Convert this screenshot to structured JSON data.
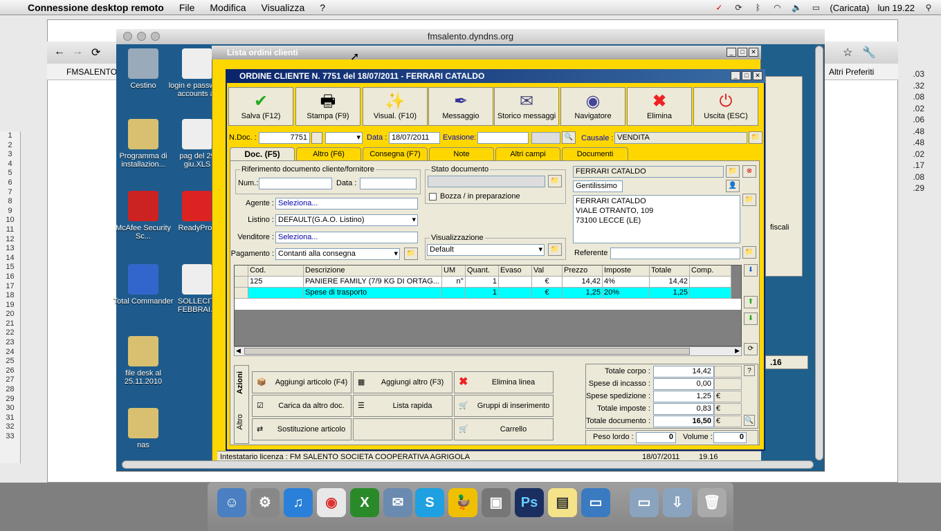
{
  "menubar": {
    "app": "Connessione desktop remoto",
    "menus": [
      "File",
      "Modifica",
      "Visualizza",
      "?"
    ],
    "battery": "(Caricata)",
    "clock": "lun 19.22"
  },
  "rd_title": "fmsalento.dyndns.org",
  "chrome": {
    "bookmark": "FMSALENTO",
    "other_bookmarks": "Altri Preferiti"
  },
  "desktop_icons": [
    {
      "label": "Cestino"
    },
    {
      "label": "login e password accounts ar"
    },
    {
      "label": "Programma di installazion..."
    },
    {
      "label": "pag del 29 giu.XLS"
    },
    {
      "label": "McAfee Security Sc..."
    },
    {
      "label": "ReadyProd"
    },
    {
      "label": "Total Commander"
    },
    {
      "label": "SOLLECITI FEBBRAI..."
    },
    {
      "label": "file desk al 25.11.2010"
    },
    {
      "label": "nas"
    }
  ],
  "sheet_rows": [
    "1",
    "2",
    "3",
    "4",
    "5",
    "6",
    "7",
    "8",
    "9",
    "10",
    "11",
    "12",
    "13",
    "14",
    "15",
    "16",
    "17",
    "18",
    "19",
    "20",
    "21",
    "22",
    "23",
    "24",
    "25",
    "26",
    "27",
    "28",
    "29",
    "30",
    "31",
    "32",
    "33"
  ],
  "right_values": [
    ".03",
    ".32",
    ".08",
    ".02",
    ".06",
    ".48",
    ".48",
    ".02",
    ".17",
    ".08",
    ".29"
  ],
  "lista": {
    "title": "Lista ordini clienti",
    "status_left": "Intestatario licenza : FM SALENTO SOCIETA COOPERATIVA AGRIGOLA",
    "status_date": "18/07/2011",
    "status_time": "19.16",
    "side_label": "fiscali",
    "side_value": ".16"
  },
  "ordine": {
    "title": "ORDINE CLIENTE N. 7751  del 18/07/2011 - FERRARI CATALDO",
    "toolbar": [
      "Salva (F12)",
      "Stampa (F9)",
      "Visual. (F10)",
      "Messaggio",
      "Storico messaggi",
      "Navigatore",
      "Elimina",
      "Uscita (ESC)"
    ],
    "ndoc_label": "N.Doc. :",
    "ndoc": "7751",
    "data_label": "Data :",
    "data": "18/07/2011",
    "evasione_label": "Evasione:",
    "causale_label": "Causale :",
    "causale": "VENDITA",
    "tabs": [
      "Doc. (F5)",
      "Altro (F6)",
      "Consegna (F7)",
      "Note",
      "Altri campi",
      "Documenti"
    ],
    "rif_group": "Riferimento documento cliente/fornitore",
    "num_label": "Num.:",
    "data2_label": "Data :",
    "agente_label": "Agente :",
    "agente": "Seleziona...",
    "listino_label": "Listino :",
    "listino": "DEFAULT(G.A.O. Listino)",
    "venditore_label": "Venditore :",
    "venditore": "Seleziona...",
    "pagamento_label": "Pagamento :",
    "pagamento": "Contanti alla consegna",
    "stato_group": "Stato documento",
    "bozza": "Bozza / in preparazione",
    "visual_group": "Visualizzazione",
    "visual": "Default",
    "cliente": "FERRARI CATALDO",
    "saluto": "Gentilissimo",
    "indirizzo": [
      "FERRARI CATALDO",
      "VIALE OTRANTO, 109",
      "73100 LECCE (LE)"
    ],
    "referente_label": "Referente",
    "grid_headers": [
      "Cod.",
      "Descrizione",
      "UM",
      "Quant.",
      "Evaso",
      "Val",
      "Prezzo",
      "Imposte",
      "Totale",
      "Comp."
    ],
    "grid_rows": [
      [
        "125",
        "PANIERE FAMILY (7/9 KG DI ORTAG...",
        "n°",
        "1",
        "",
        "€",
        "14,42",
        "4%",
        "14,42",
        ""
      ],
      [
        "",
        "Spese di trasporto",
        "",
        "1",
        "",
        "€",
        "1,25",
        "20%",
        "1,25",
        ""
      ]
    ],
    "side_tabs": [
      "Azioni",
      "Altro"
    ],
    "actions": [
      "Aggiungi articolo (F4)",
      "Aggiungi altro (F3)",
      "Elimina linea",
      "Carica da altro doc.",
      "Lista rapida",
      "Gruppi di inserimento",
      "Sostituzione articolo",
      "",
      "Carrello"
    ],
    "totals": [
      {
        "label": "Totale corpo :",
        "value": "14,42",
        "cur": ""
      },
      {
        "label": "Spese di incasso :",
        "value": "0,00",
        "cur": ""
      },
      {
        "label": "Spese spedizione :",
        "value": "1,25",
        "cur": "€"
      },
      {
        "label": "Totale imposte :",
        "value": "0,83",
        "cur": "€"
      },
      {
        "label": "Totale documento :",
        "value": "16,50",
        "cur": "€"
      }
    ],
    "peso_label": "Peso lordo :",
    "peso": "0",
    "volume_label": "Volume :",
    "volume": "0"
  }
}
